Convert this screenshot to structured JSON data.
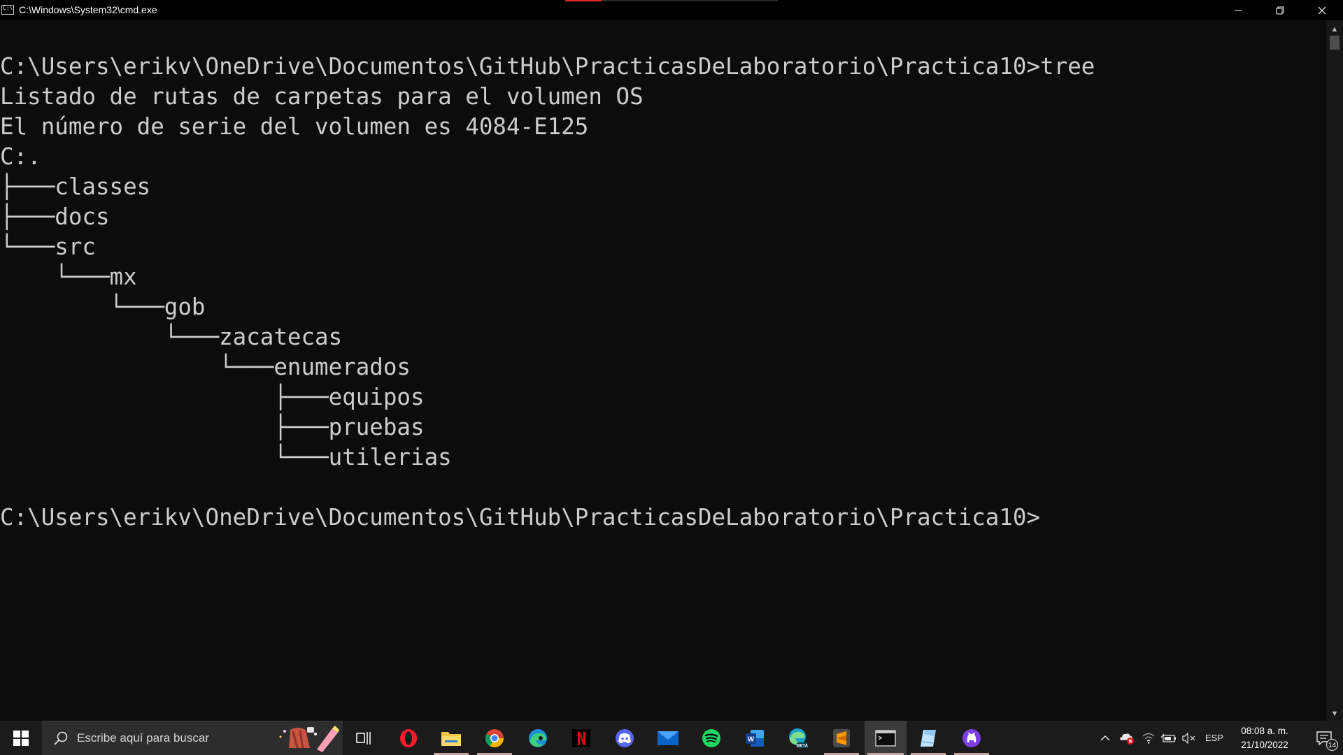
{
  "window": {
    "title": "C:\\Windows\\System32\\cmd.exe",
    "progress_fraction": 0.17,
    "controls": [
      "minimize",
      "restore",
      "close"
    ]
  },
  "console": {
    "lines": [
      "C:\\Users\\erikv\\OneDrive\\Documentos\\GitHub\\PracticasDeLaboratorio\\Practica10>tree",
      "Listado de rutas de carpetas para el volumen OS",
      "El número de serie del volumen es 4084-E125",
      "C:.",
      "├───classes",
      "├───docs",
      "└───src",
      "    └───mx",
      "        └───gob",
      "            └───zacatecas",
      "                └───enumerados",
      "                    ├───equipos",
      "                    ├───pruebas",
      "                    └───utilerias",
      "",
      "C:\\Users\\erikv\\OneDrive\\Documentos\\GitHub\\PracticasDeLaboratorio\\Practica10>"
    ]
  },
  "taskbar": {
    "search_placeholder": "Escribe aquí para buscar",
    "apps": [
      {
        "name": "task-view",
        "icon": "task-view-icon"
      },
      {
        "name": "opera",
        "icon": "opera-icon",
        "open": false
      },
      {
        "name": "file-explorer",
        "icon": "folder-icon",
        "open": true
      },
      {
        "name": "chrome",
        "icon": "chrome-icon",
        "open": true
      },
      {
        "name": "edge",
        "icon": "edge-icon",
        "open": false
      },
      {
        "name": "netflix",
        "icon": "netflix-icon",
        "open": false
      },
      {
        "name": "discord",
        "icon": "discord-icon",
        "open": false
      },
      {
        "name": "mail",
        "icon": "mail-icon",
        "open": false
      },
      {
        "name": "spotify",
        "icon": "spotify-icon",
        "open": false
      },
      {
        "name": "word",
        "icon": "word-icon",
        "open": false
      },
      {
        "name": "edge-beta",
        "icon": "edge-beta-icon",
        "open": false
      },
      {
        "name": "sublime-text",
        "icon": "sublime-icon",
        "open": true
      },
      {
        "name": "cmd",
        "icon": "terminal-icon",
        "open": true,
        "active": true
      },
      {
        "name": "notes",
        "icon": "notes-icon",
        "open": true
      },
      {
        "name": "github-desktop",
        "icon": "github-icon",
        "open": true
      }
    ],
    "tray": {
      "language": "ESP",
      "time": "08:08 a. m.",
      "date": "21/10/2022",
      "notifications_count": "14"
    }
  },
  "colors": {
    "console_bg": "#0c0c0c",
    "console_fg": "#cccccc",
    "taskbar_bg": "#1b1b1b",
    "windows_accent": "#e02b2b"
  }
}
